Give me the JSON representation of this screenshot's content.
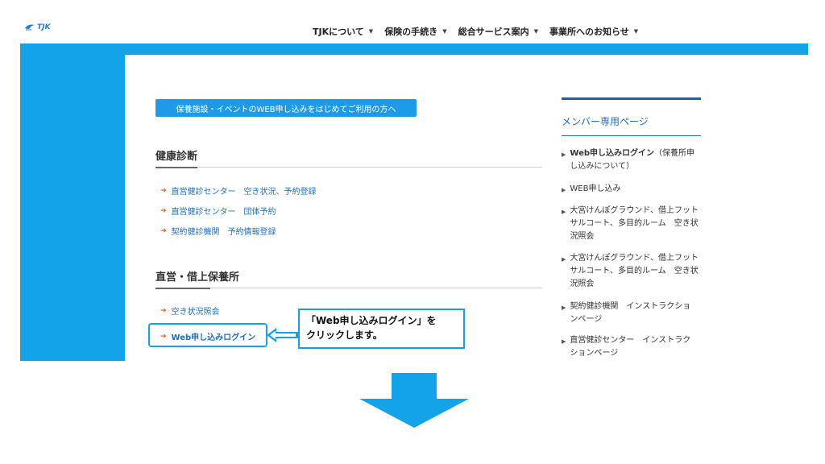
{
  "brand": {
    "logo_text": "TJK",
    "brand_color": "#1f7fd4"
  },
  "topnav": [
    {
      "label": "TJKについて"
    },
    {
      "label": "保険の手続き"
    },
    {
      "label": "総合サービス案内"
    },
    {
      "label": "事業所へのお知らせ"
    }
  ],
  "cta": {
    "label": "保養施設・イベントのWEB申し込みをはじめてご利用の方へ"
  },
  "sections": {
    "health": {
      "title": "健康診断",
      "links": [
        "直営健診センター　空き状況、予約登録",
        "直営健診センター　団体予約",
        "契約健診機関　予約情報登録"
      ]
    },
    "nursery": {
      "title": "直営・借上保養所",
      "links": [
        "空き状況照会",
        "Web申し込みログイン"
      ]
    }
  },
  "callout": {
    "line1": "「Web申し込みログイン」を",
    "line2": "クリックします。"
  },
  "sidebar": {
    "title": "メンバー専用ページ",
    "items": [
      {
        "html": "<b>Web申し込みログイン</b>（保養所申し込みについて）"
      },
      {
        "label": "WEB申し込み"
      },
      {
        "label": "大宮けんぽグラウンド、借上フットサルコート、多目的ルーム　空き状況照会"
      },
      {
        "label": "大宮けんぽグラウンド、借上フットサルコート、多目的ルーム　空き状況照会"
      },
      {
        "label": "契約健診機関　インストラクションページ"
      },
      {
        "label": "直営健診センター　インストラクションページ"
      }
    ]
  },
  "colors": {
    "accent": "#13a3e9",
    "link": "#1a6fc2",
    "arrow": "#e2591b",
    "sidebar_line": "#1564b3"
  }
}
